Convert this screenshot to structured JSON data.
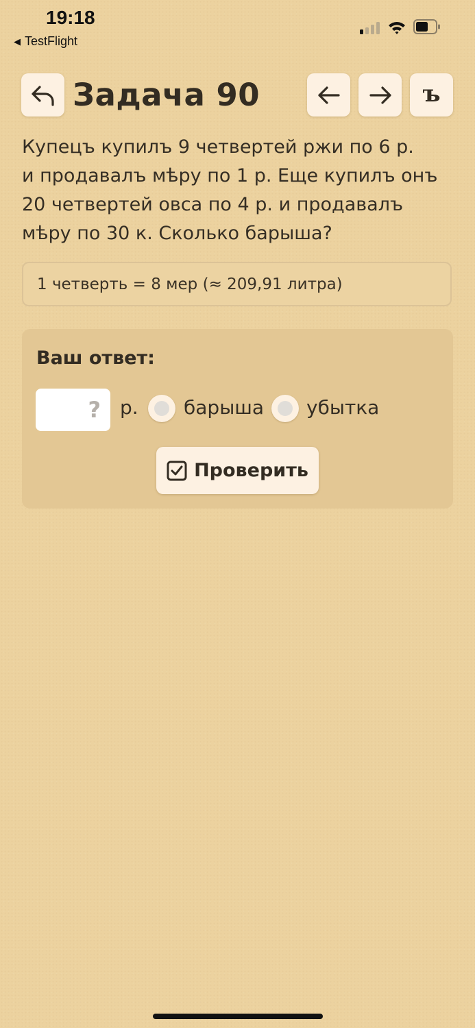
{
  "status_bar": {
    "time": "19:18",
    "back_app": "TestFlight",
    "back_arrow_glyph": "◀"
  },
  "header": {
    "title": "Задача 90",
    "yer_button_label": "ъ",
    "icons": {
      "back": "undo-arrow-icon",
      "prev": "arrow-left-icon",
      "next": "arrow-right-icon"
    }
  },
  "problem": {
    "lines": [
      "Купецъ купилъ 9 четвертей ржи по 6 р.",
      "и продавалъ мѣру по 1 р. Еще купилъ онъ",
      "20 четвертей овса по 4 р. и продавалъ",
      "мѣру по 30 к. Сколько барыша?"
    ]
  },
  "hint": {
    "text": "1 четверть = 8 мер (≈ 209,91 литра)"
  },
  "answer": {
    "label": "Ваш ответ:",
    "input_placeholder": "?",
    "input_value": "",
    "unit": "р.",
    "options": [
      {
        "label": "барыша",
        "selected": false
      },
      {
        "label": "убытка",
        "selected": false
      }
    ],
    "check_button_label": "Проверить",
    "check_icon": "checkbox-icon"
  },
  "colors": {
    "background": "#ecd29f",
    "button_bg": "#fdf1e2",
    "panel_bg": "#e3c794",
    "text": "#352e24"
  }
}
